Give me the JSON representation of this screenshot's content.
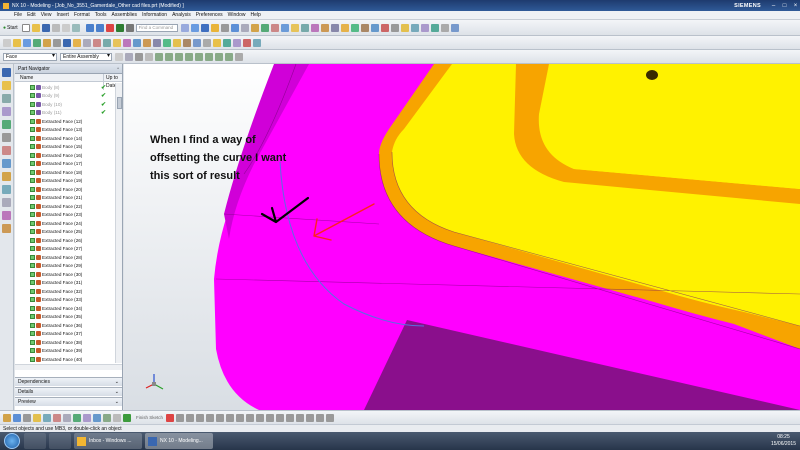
{
  "window": {
    "title": "NX 10 - Modeling - [Job_No_3551_Gamerdale_Other cad files.prt (Modified) ]",
    "brand": "SIEMENS"
  },
  "menu": [
    "File",
    "Edit",
    "View",
    "Insert",
    "Format",
    "Tools",
    "Assemblies",
    "Information",
    "Analysis",
    "Preferences",
    "Window",
    "Help"
  ],
  "toolbar": {
    "start_label": "Start",
    "find_placeholder": "Find a Command"
  },
  "filters": {
    "type_filter": "Face",
    "scope_filter": "Entire Assembly"
  },
  "navigator": {
    "title": "Part Navigator",
    "col_name": "Name",
    "col_uptodate": "Up to Date",
    "items": [
      {
        "label": "Body (8)",
        "kind": "body"
      },
      {
        "label": "Body (9)",
        "kind": "body"
      },
      {
        "label": "Body (10)",
        "kind": "body"
      },
      {
        "label": "Body (11)",
        "kind": "body"
      },
      {
        "label": "Extracted Face (12)",
        "kind": "face"
      },
      {
        "label": "Extracted Face (13)",
        "kind": "face"
      },
      {
        "label": "Extracted Face (14)",
        "kind": "face"
      },
      {
        "label": "Extracted Face (15)",
        "kind": "face"
      },
      {
        "label": "Extracted Face (16)",
        "kind": "face"
      },
      {
        "label": "Extracted Face (17)",
        "kind": "face"
      },
      {
        "label": "Extracted Face (18)",
        "kind": "face"
      },
      {
        "label": "Extracted Face (19)",
        "kind": "face"
      },
      {
        "label": "Extracted Face (20)",
        "kind": "face"
      },
      {
        "label": "Extracted Face (21)",
        "kind": "face"
      },
      {
        "label": "Extracted Face (22)",
        "kind": "face"
      },
      {
        "label": "Extracted Face (23)",
        "kind": "face"
      },
      {
        "label": "Extracted Face (24)",
        "kind": "face"
      },
      {
        "label": "Extracted Face (25)",
        "kind": "face"
      },
      {
        "label": "Extracted Face (26)",
        "kind": "face"
      },
      {
        "label": "Extracted Face (27)",
        "kind": "face"
      },
      {
        "label": "Extracted Face (28)",
        "kind": "face"
      },
      {
        "label": "Extracted Face (29)",
        "kind": "face"
      },
      {
        "label": "Extracted Face (30)",
        "kind": "face"
      },
      {
        "label": "Extracted Face (31)",
        "kind": "face"
      },
      {
        "label": "Extracted Face (32)",
        "kind": "face"
      },
      {
        "label": "Extracted Face (33)",
        "kind": "face"
      },
      {
        "label": "Extracted Face (34)",
        "kind": "face"
      },
      {
        "label": "Extracted Face (35)",
        "kind": "face"
      },
      {
        "label": "Extracted Face (36)",
        "kind": "face"
      },
      {
        "label": "Extracted Face (37)",
        "kind": "face"
      },
      {
        "label": "Extracted Face (38)",
        "kind": "face"
      },
      {
        "label": "Extracted Face (39)",
        "kind": "face"
      },
      {
        "label": "Extracted Face (40)",
        "kind": "face"
      },
      {
        "label": "Extracted Face (41)",
        "kind": "face"
      }
    ],
    "panes": [
      "Dependencies",
      "Details",
      "Preview"
    ]
  },
  "annotation": "When I find a way of offsetting the curve I want this sort of result",
  "bottom_toolbar": {
    "sketch_label": "Finish Sketch"
  },
  "status": "Select objects and use MB3, or double-click an object",
  "taskbar": {
    "apps": [
      {
        "label": "Inbox - Windows ...",
        "active": false
      },
      {
        "label": "NX 10 - Modeling...",
        "active": true
      }
    ],
    "time": "08:25",
    "date": "15/06/2015"
  },
  "colors": {
    "magenta": "#ff00ff",
    "dark_magenta": "#8a0f8c",
    "yellow": "#fff200",
    "orange": "#f7a400",
    "arrow_red": "#ff2020"
  }
}
